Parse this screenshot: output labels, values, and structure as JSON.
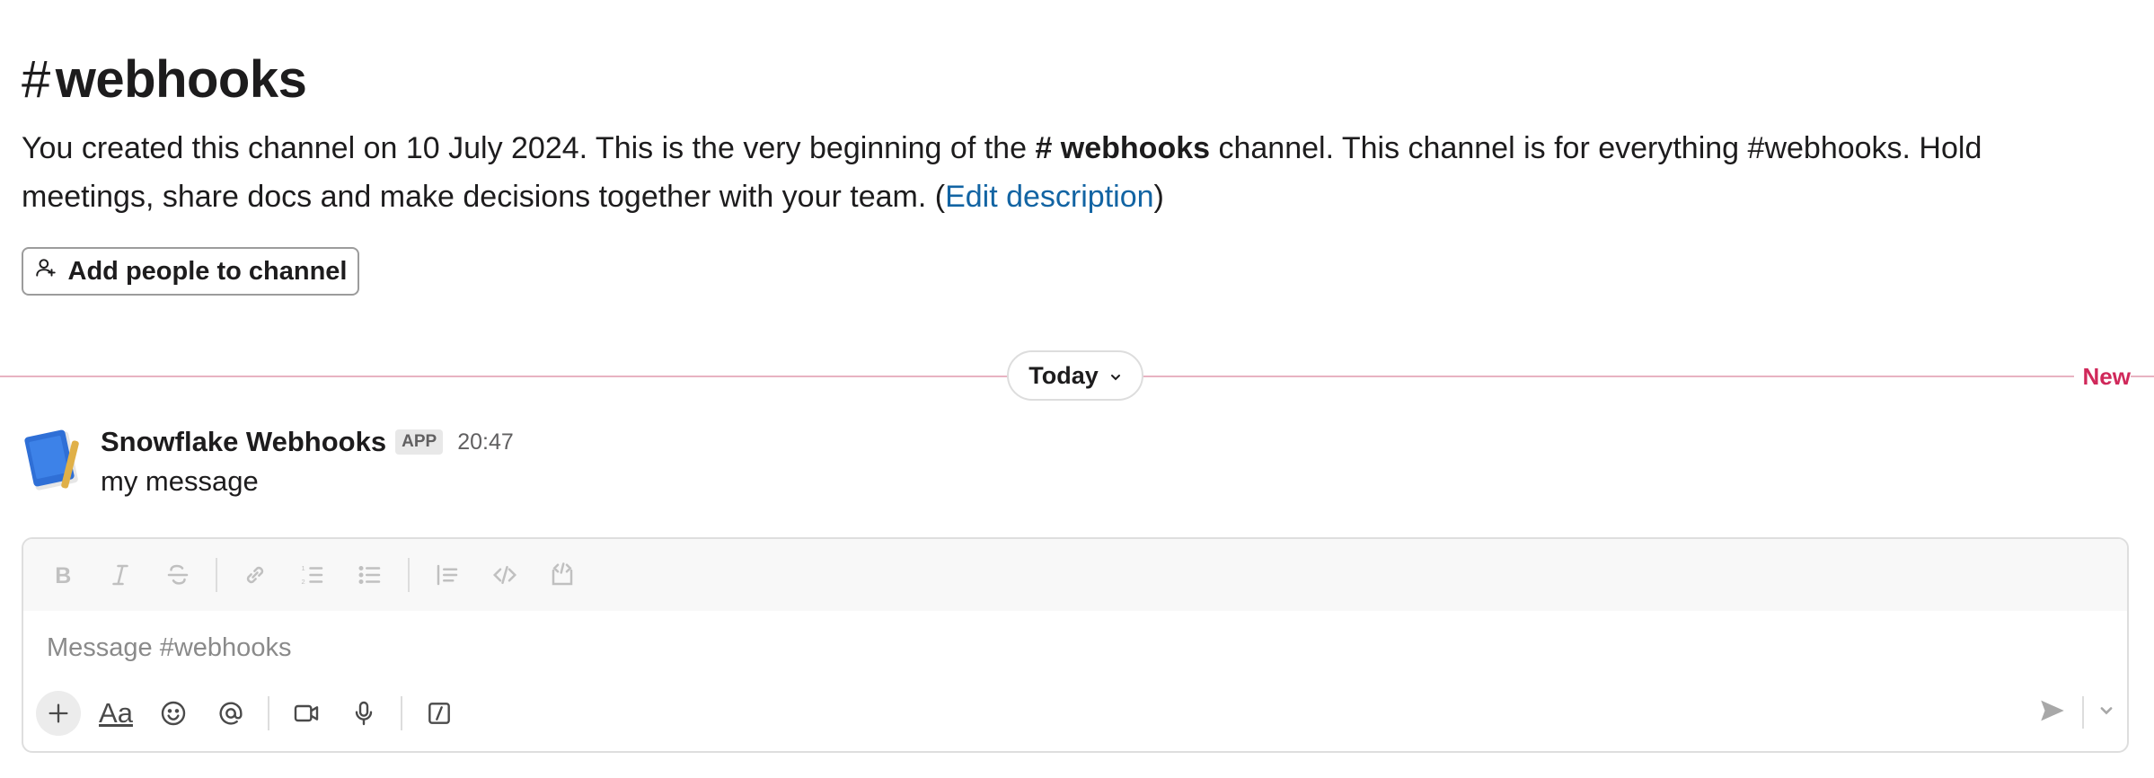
{
  "intro": {
    "hash": "#",
    "channel_name": "webhooks",
    "desc_pre": "You created this channel on 10 July 2024. This is the very beginning of the ",
    "desc_bold": "# webhooks",
    "desc_post": " channel. This channel is for everything #webhooks. Hold meetings, share docs and make decisions together with your team. (",
    "edit_link": "Edit description",
    "desc_close": ")"
  },
  "add_people_label": "Add people to channel",
  "divider": {
    "today_label": "Today",
    "new_label": "New"
  },
  "message": {
    "sender": "Snowflake Webhooks",
    "badge": "APP",
    "time": "20:47",
    "text": "my message"
  },
  "composer": {
    "placeholder": "Message #webhooks",
    "format_icons": [
      "bold-icon",
      "italic-icon",
      "strikethrough-icon",
      "link-icon",
      "numbered-list-icon",
      "bulleted-list-icon",
      "blockquote-icon",
      "code-icon",
      "code-block-icon"
    ],
    "aa_label": "Aa"
  }
}
